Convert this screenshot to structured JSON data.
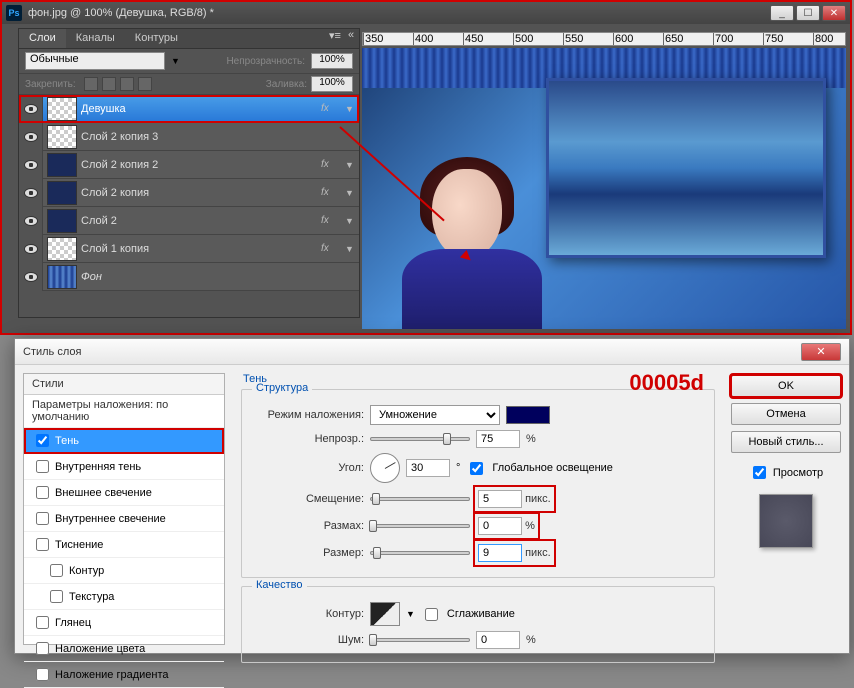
{
  "window": {
    "title": "фон.jpg @ 100% (Девушка, RGB/8) *",
    "ruler_marks": [
      "350",
      "400",
      "450",
      "500",
      "550",
      "600",
      "650",
      "700",
      "750",
      "800"
    ]
  },
  "win_buttons": {
    "min": "_",
    "max": "☐",
    "close": "✕"
  },
  "layers_panel": {
    "tabs": [
      "Слои",
      "Каналы",
      "Контуры"
    ],
    "blend_mode": "Обычные",
    "opacity_lbl": "Непрозрачность:",
    "opacity_val": "100%",
    "fill_lbl": "Заливка:",
    "fill_val": "100%",
    "lock_lbl": "Закрепить:",
    "layers": [
      {
        "name": "Девушка",
        "fx": true,
        "sel": true
      },
      {
        "name": "Слой 2 копия 3",
        "fx": false
      },
      {
        "name": "Слой 2 копия 2",
        "fx": true
      },
      {
        "name": "Слой 2 копия",
        "fx": true
      },
      {
        "name": "Слой 2",
        "fx": true
      },
      {
        "name": "Слой 1 копия",
        "fx": true
      },
      {
        "name": "Фон",
        "fx": false
      }
    ]
  },
  "annotation": "00005d",
  "dialog": {
    "title": "Стиль слоя",
    "styles_header": "Стили",
    "blend_defaults": "Параметры наложения: по умолчанию",
    "items": [
      {
        "label": "Тень",
        "checked": true,
        "sel": true,
        "indent": false
      },
      {
        "label": "Внутренняя тень",
        "checked": false,
        "indent": false
      },
      {
        "label": "Внешнее свечение",
        "checked": false,
        "indent": false
      },
      {
        "label": "Внутреннее свечение",
        "checked": false,
        "indent": false
      },
      {
        "label": "Тиснение",
        "checked": false,
        "indent": false
      },
      {
        "label": "Контур",
        "checked": false,
        "indent": true
      },
      {
        "label": "Текстура",
        "checked": false,
        "indent": true
      },
      {
        "label": "Глянец",
        "checked": false,
        "indent": false
      },
      {
        "label": "Наложение цвета",
        "checked": false,
        "indent": false
      },
      {
        "label": "Наложение градиента",
        "checked": false,
        "indent": false
      }
    ],
    "shadow": {
      "heading": "Тень",
      "structure": "Структура",
      "blend_lbl": "Режим наложения:",
      "blend_mode": "Умножение",
      "opacity_lbl": "Непрозр.:",
      "opacity_val": "75",
      "opacity_unit": "%",
      "angle_lbl": "Угол:",
      "angle_val": "30",
      "angle_unit": "°",
      "global_light": "Глобальное освещение",
      "distance_lbl": "Смещение:",
      "distance_val": "5",
      "distance_unit": "пикс.",
      "spread_lbl": "Размах:",
      "spread_val": "0",
      "spread_unit": "%",
      "size_lbl": "Размер:",
      "size_val": "9",
      "size_unit": "пикс.",
      "quality": "Качество",
      "contour_lbl": "Контур:",
      "antialiased": "Сглаживание",
      "noise_lbl": "Шум:",
      "noise_val": "0",
      "noise_unit": "%"
    },
    "buttons": {
      "ok": "OK",
      "cancel": "Отмена",
      "new_style": "Новый стиль...",
      "preview": "Просмотр"
    }
  }
}
